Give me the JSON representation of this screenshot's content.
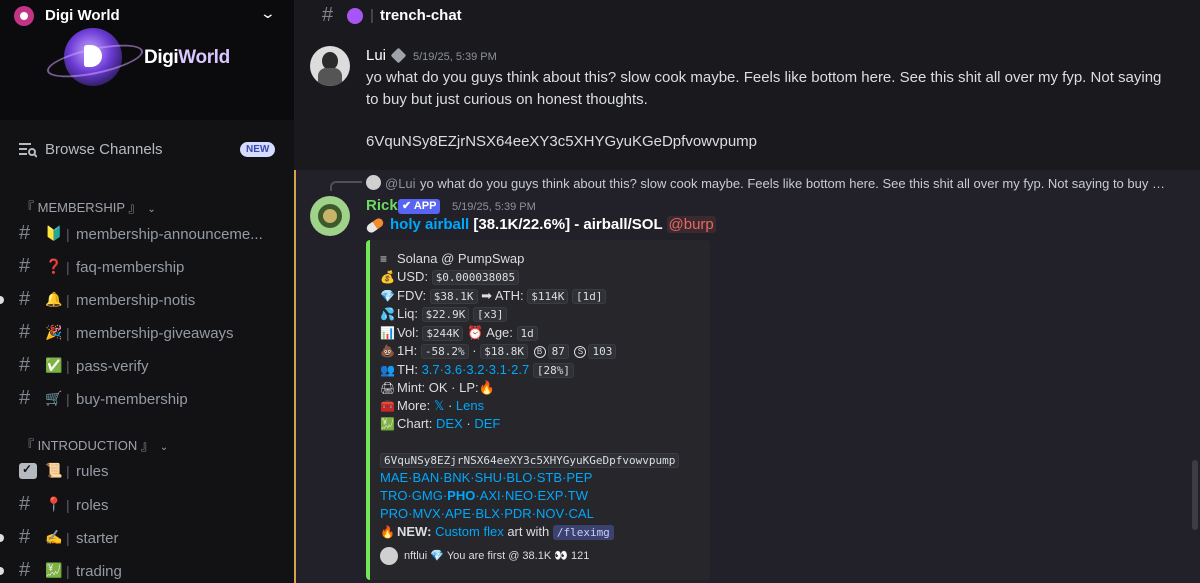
{
  "server": {
    "name": "Digi World",
    "banner_title_a": "Digi",
    "banner_title_b": "World"
  },
  "sidebar": {
    "browse_label": "Browse Channels",
    "browse_badge": "NEW",
    "categories": [
      {
        "label": "『 MEMBERSHIP 』"
      },
      {
        "label": "『 INTRODUCTION 』"
      }
    ],
    "channels": [
      {
        "emoji": "🔰",
        "name": "membership-announceme..."
      },
      {
        "emoji": "❓",
        "name": "faq-membership"
      },
      {
        "emoji": "🔔",
        "name": "membership-notis"
      },
      {
        "emoji": "🎉",
        "name": "membership-giveaways"
      },
      {
        "emoji": "✅",
        "name": "pass-verify"
      },
      {
        "emoji": "🛒",
        "name": "buy-membership"
      },
      {
        "emoji": "📜",
        "name": "rules"
      },
      {
        "emoji": "📍",
        "name": "roles"
      },
      {
        "emoji": "✍️",
        "name": "starter"
      },
      {
        "emoji": "💹",
        "name": "trading"
      }
    ]
  },
  "channel": {
    "title": "trench-chat"
  },
  "messages": {
    "lui": {
      "author": "Lui",
      "timestamp": "5/19/25, 5:39 PM",
      "text": "yo what do you guys think about this? slow cook maybe. Feels like bottom here. See this shit all over my fyp. Not saying to buy but just curious on honest thoughts.",
      "ca": "6VquNSy8EZjrNSX64eeXY3c5XHYGyuKGeDpfvowvpump"
    },
    "reply": {
      "mention": "@Lui",
      "text": "yo what do you guys think about this? slow cook maybe. Feels like bottom here. See this shit all over my fyp. Not saying to buy b..."
    },
    "rick": {
      "author": "Rick",
      "app_badge": "✔ APP",
      "timestamp": "5/19/25, 5:39 PM",
      "token_link": "holy airball",
      "token_rest": " [38.1K/22.6%] - airball/SOL ",
      "mention": "@burp",
      "embed": {
        "chain": "Solana @ PumpSwap",
        "usd_label": "USD:",
        "usd": "$0.000038085",
        "fdv_label": "FDV:",
        "fdv": "$38.1K",
        "ath_label": "➡ ATH:",
        "ath": "$114K",
        "ath_age": "[1d]",
        "liq_label": "Liq:",
        "liq": "$22.9K",
        "liq_mult": "[x3]",
        "vol_label": "Vol:",
        "vol": "$244K",
        "age_label": "Age:",
        "age": "1d",
        "h1_label": "1H:",
        "h1": "-58.2%",
        "h1_sep": "·",
        "h1_vol": "$18.8K",
        "b_count": "87",
        "s_count": "103",
        "th_label": "TH:",
        "th_values": "3.7·3.6·3.2·3.1·2.7",
        "th_total": "[28%]",
        "mint": "Mint: OK · LP:",
        "more_label": "More:",
        "more_x": "𝕏",
        "more_sep": " · ",
        "more_lens": "Lens",
        "chart_label": "Chart:",
        "chart_dex": "DEX",
        "chart_sep": " · ",
        "chart_def": "DEF",
        "ca": "6VquNSy8EZjrNSX64eeXY3c5XHYGyuKGeDpfvowvpump",
        "links_1": "MAE·BAN·BNK·SHU·BLO·STB·PEP",
        "links_2a": "TRO·GMG·",
        "links_2b": "PHO",
        "links_2c": "·AXI·NEO·EXP·TW",
        "links_3": "PRO·MVX·APE·BLX·PDR·NOV·CAL",
        "new_label": "NEW:",
        "new_link": "Custom flex",
        "new_text": " art with ",
        "new_cmd": "/fleximg",
        "footer": "nftlui 💎 You are first @ 38.1K 👀 121"
      }
    }
  },
  "colors": {
    "mention_bar": "#d8a24a",
    "embed_bar": "#74e65a",
    "rick_name": "#6cdb62",
    "link": "#00a8fc"
  }
}
